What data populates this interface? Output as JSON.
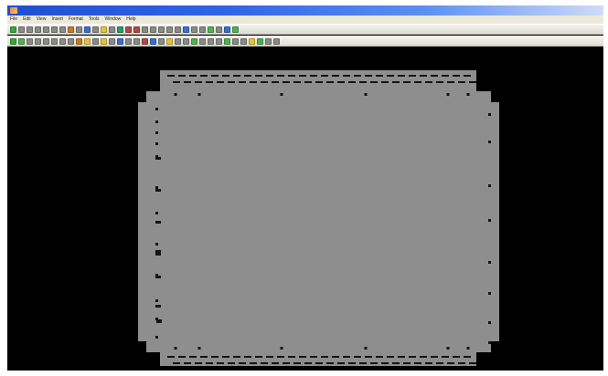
{
  "window": {
    "title": ""
  },
  "menu": {
    "items": [
      "File",
      "Edit",
      "View",
      "Insert",
      "Format",
      "Tools",
      "Window",
      "Help",
      "",
      "",
      ""
    ]
  },
  "toolbars": [
    {
      "icons": [
        "green-check-icon",
        "gray-tool-icon",
        "gray-tool-icon",
        "gray-tool-icon",
        "gray-tool-icon",
        "gray-tool-icon",
        "gray-tool-icon",
        "undo-icon",
        "gray-tool-icon",
        "blue-tool-icon",
        "gray-tool-icon",
        "yellow-tool-icon",
        "gray-tool-icon",
        "refresh-icon",
        "arrow-icon",
        "arrow-icon",
        "gray-tool-icon",
        "gray-tool-icon",
        "gray-tool-icon",
        "gray-tool-icon",
        "gray-tool-icon",
        "blue-tool-icon",
        "gray-tool-icon",
        "gray-tool-icon",
        "green-tool-icon",
        "gray-tool-icon",
        "blue-tool-icon",
        "green-tool-icon"
      ]
    },
    {
      "icons": [
        "green-check-icon",
        "green-tool-icon",
        "gray-tool-icon",
        "gray-tool-icon",
        "gray-tool-icon",
        "gray-tool-icon",
        "gray-tool-icon",
        "gray-tool-icon",
        "undo-icon",
        "yellow-tool-icon",
        "gray-tool-icon",
        "yellow-tool-icon",
        "gray-tool-icon",
        "blue-tool-icon",
        "gray-tool-icon",
        "gray-tool-icon",
        "arrow-icon",
        "blue-tool-icon",
        "gray-tool-icon",
        "yellow-tool-icon",
        "gray-tool-icon",
        "gray-tool-icon",
        "green-tool-icon",
        "gray-tool-icon",
        "gray-tool-icon",
        "gray-tool-icon",
        "green-tool-icon",
        "gray-tool-icon",
        "gray-tool-icon",
        "yellow-tool-icon",
        "green-tool-icon",
        "gray-tool-icon",
        "gray-tool-icon"
      ]
    }
  ],
  "colors": {
    "titlebar": "#2f63e8",
    "toolbar_bg": "#e6e6dc",
    "canvas_bg": "#000000",
    "panel_fill": "#8e8e8e",
    "hole_fill": "#141414",
    "green-check-icon": "#3aa53a",
    "gray-tool-icon": "#8a8a8a",
    "undo-icon": "#c77a2a",
    "blue-tool-icon": "#3a6fd0",
    "yellow-tool-icon": "#e2c43a",
    "green-tool-icon": "#52b052",
    "refresh-icon": "#2a9a6a",
    "arrow-icon": "#b04a4a"
  }
}
